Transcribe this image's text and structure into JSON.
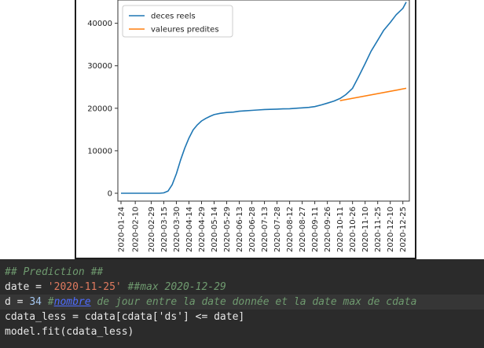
{
  "chart_data": {
    "type": "line",
    "ylim": [
      0,
      44000
    ],
    "yticks": [
      0,
      10000,
      20000,
      30000,
      40000
    ],
    "ytick_labels": [
      "0",
      "10000",
      "20000",
      "30000",
      "40000"
    ],
    "xlim": [
      "2020-01-24",
      "2020-12-29"
    ],
    "xtick_labels": [
      "2020-01-24",
      "2020-02-10",
      "2020-02-29",
      "2020-03-15",
      "2020-03-30",
      "2020-04-14",
      "2020-04-29",
      "2020-05-14",
      "2020-05-29",
      "2020-06-13",
      "2020-06-28",
      "2020-07-13",
      "2020-07-28",
      "2020-08-12",
      "2020-08-27",
      "2020-09-11",
      "2020-09-26",
      "2020-10-11",
      "2020-10-26",
      "2020-11-10",
      "2020-11-25",
      "2020-12-10",
      "2020-12-25"
    ],
    "legend_position": "top-left",
    "series": [
      {
        "name": "deces reels",
        "color": "#1f77b4",
        "x": [
          "2020-01-24",
          "2020-02-10",
          "2020-02-29",
          "2020-03-10",
          "2020-03-15",
          "2020-03-20",
          "2020-03-25",
          "2020-03-30",
          "2020-04-04",
          "2020-04-09",
          "2020-04-14",
          "2020-04-19",
          "2020-04-24",
          "2020-04-29",
          "2020-05-04",
          "2020-05-09",
          "2020-05-14",
          "2020-05-21",
          "2020-05-29",
          "2020-06-06",
          "2020-06-13",
          "2020-06-20",
          "2020-06-28",
          "2020-07-05",
          "2020-07-13",
          "2020-07-20",
          "2020-07-28",
          "2020-08-04",
          "2020-08-12",
          "2020-08-20",
          "2020-08-27",
          "2020-09-04",
          "2020-09-11",
          "2020-09-19",
          "2020-09-26",
          "2020-10-04",
          "2020-10-11",
          "2020-10-18",
          "2020-10-26",
          "2020-11-02",
          "2020-11-10",
          "2020-11-17",
          "2020-11-25",
          "2020-12-02",
          "2020-12-10",
          "2020-12-17",
          "2020-12-25",
          "2020-12-29"
        ],
        "y": [
          0,
          0,
          0,
          0,
          100,
          500,
          2000,
          4600,
          7800,
          10600,
          13000,
          14900,
          16100,
          17000,
          17600,
          18100,
          18500,
          18800,
          19000,
          19100,
          19300,
          19400,
          19500,
          19600,
          19700,
          19750,
          19800,
          19850,
          19900,
          20000,
          20100,
          20200,
          20400,
          20800,
          21200,
          21700,
          22300,
          23200,
          24700,
          27300,
          30500,
          33400,
          36000,
          38300,
          40200,
          42000,
          43500,
          45000
        ]
      },
      {
        "name": "valeures predites",
        "color": "#ff7f0e",
        "x": [
          "2020-10-11",
          "2020-12-29"
        ],
        "y": [
          21800,
          24700
        ]
      }
    ]
  },
  "code": {
    "line1": "## Prediction ##",
    "line2_var": "date = ",
    "line2_str": "'2020-11-25'",
    "line2_comment": " ##max 2020-12-29",
    "line3_var": "d = ",
    "line3_num": "34",
    "line3_hash": " #",
    "line3_link": "nombre",
    "line3_comment": " de jour entre la date donnée et la date max de cdata",
    "line4": "cdata_less = cdata[cdata['ds'] <= date]",
    "line5": "model.fit(cdata_less)"
  }
}
